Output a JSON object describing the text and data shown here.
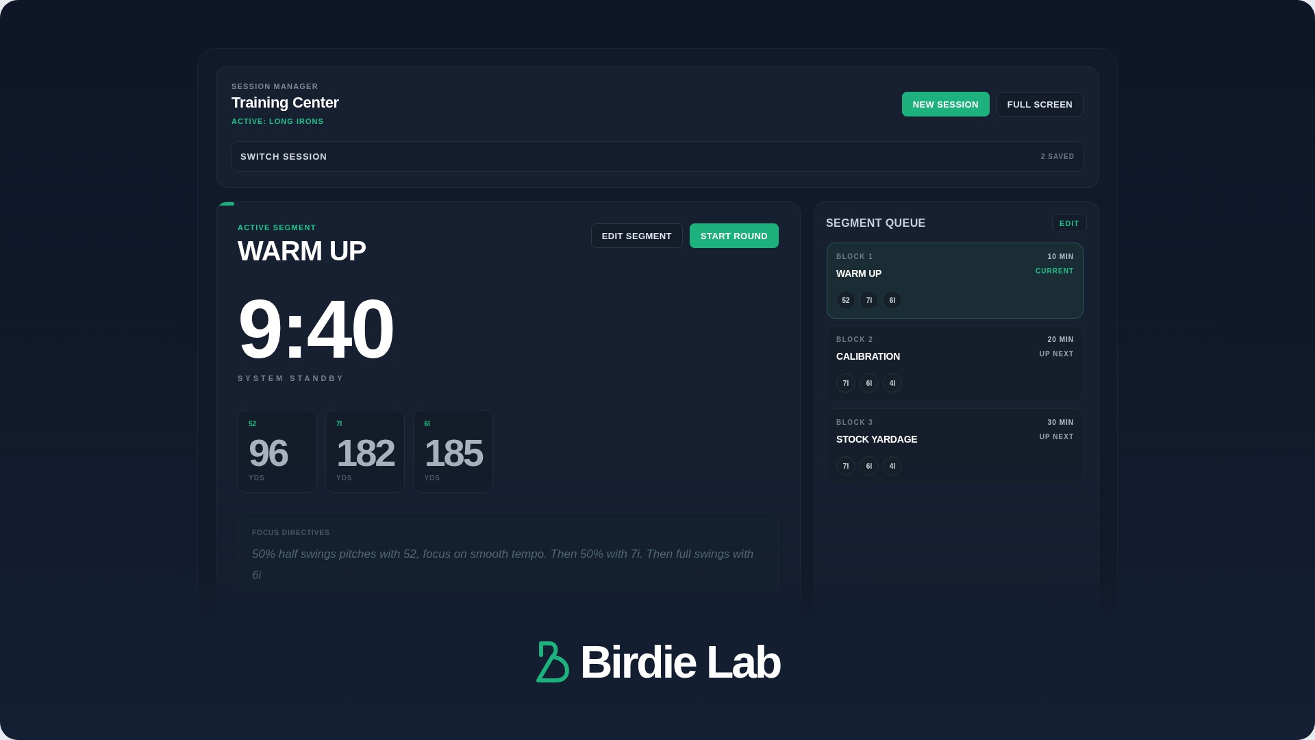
{
  "session_manager": {
    "eyebrow": "SESSION MANAGER",
    "title": "Training Center",
    "active": "ACTIVE: LONG IRONS",
    "buttons": [
      {
        "label": "NEW SESSION",
        "kind": "primary"
      },
      {
        "label": "FULL SCREEN",
        "kind": "outline"
      }
    ],
    "switch": {
      "label": "SWITCH SESSION",
      "count": "2 SAVED"
    }
  },
  "active_segment": {
    "progress": {
      "level": 0.03
    },
    "eyebrow": "ACTIVE SEGMENT",
    "title": "WARM UP",
    "buttons": [
      {
        "label": "EDIT SEGMENT",
        "kind": "outline"
      },
      {
        "label": "START ROUND",
        "kind": "primary"
      }
    ],
    "timer": "9:40",
    "status": "SYSTEM STANDBY",
    "clubs": [
      {
        "club": "52",
        "yards": "96",
        "unit": "YDS"
      },
      {
        "club": "7I",
        "yards": "182",
        "unit": "YDS"
      },
      {
        "club": "6I",
        "yards": "185",
        "unit": "YDS"
      }
    ],
    "focus": {
      "label": "FOCUS DIRECTIVES",
      "text": "50% half swings pitches with 52, focus on smooth tempo. Then 50% with 7i. Then full swings with 6i"
    }
  },
  "segment_queue": {
    "title": "SEGMENT QUEUE",
    "edit": "EDIT",
    "items": [
      {
        "block": "BLOCK 1",
        "duration": "10 MIN",
        "name": "WARM UP",
        "status": "CURRENT",
        "selected": true,
        "clubs": [
          "52",
          "7I",
          "6I"
        ]
      },
      {
        "block": "BLOCK 2",
        "duration": "20 MIN",
        "name": "CALIBRATION",
        "status": "UP NEXT",
        "selected": false,
        "clubs": [
          "7I",
          "6I",
          "4I"
        ]
      },
      {
        "block": "BLOCK 3",
        "duration": "30 MIN",
        "name": "STOCK YARDAGE",
        "status": "UP NEXT",
        "selected": false,
        "clubs": [
          "7I",
          "6I",
          "4I"
        ]
      }
    ]
  },
  "logo": {
    "name": "Birdie Lab"
  }
}
